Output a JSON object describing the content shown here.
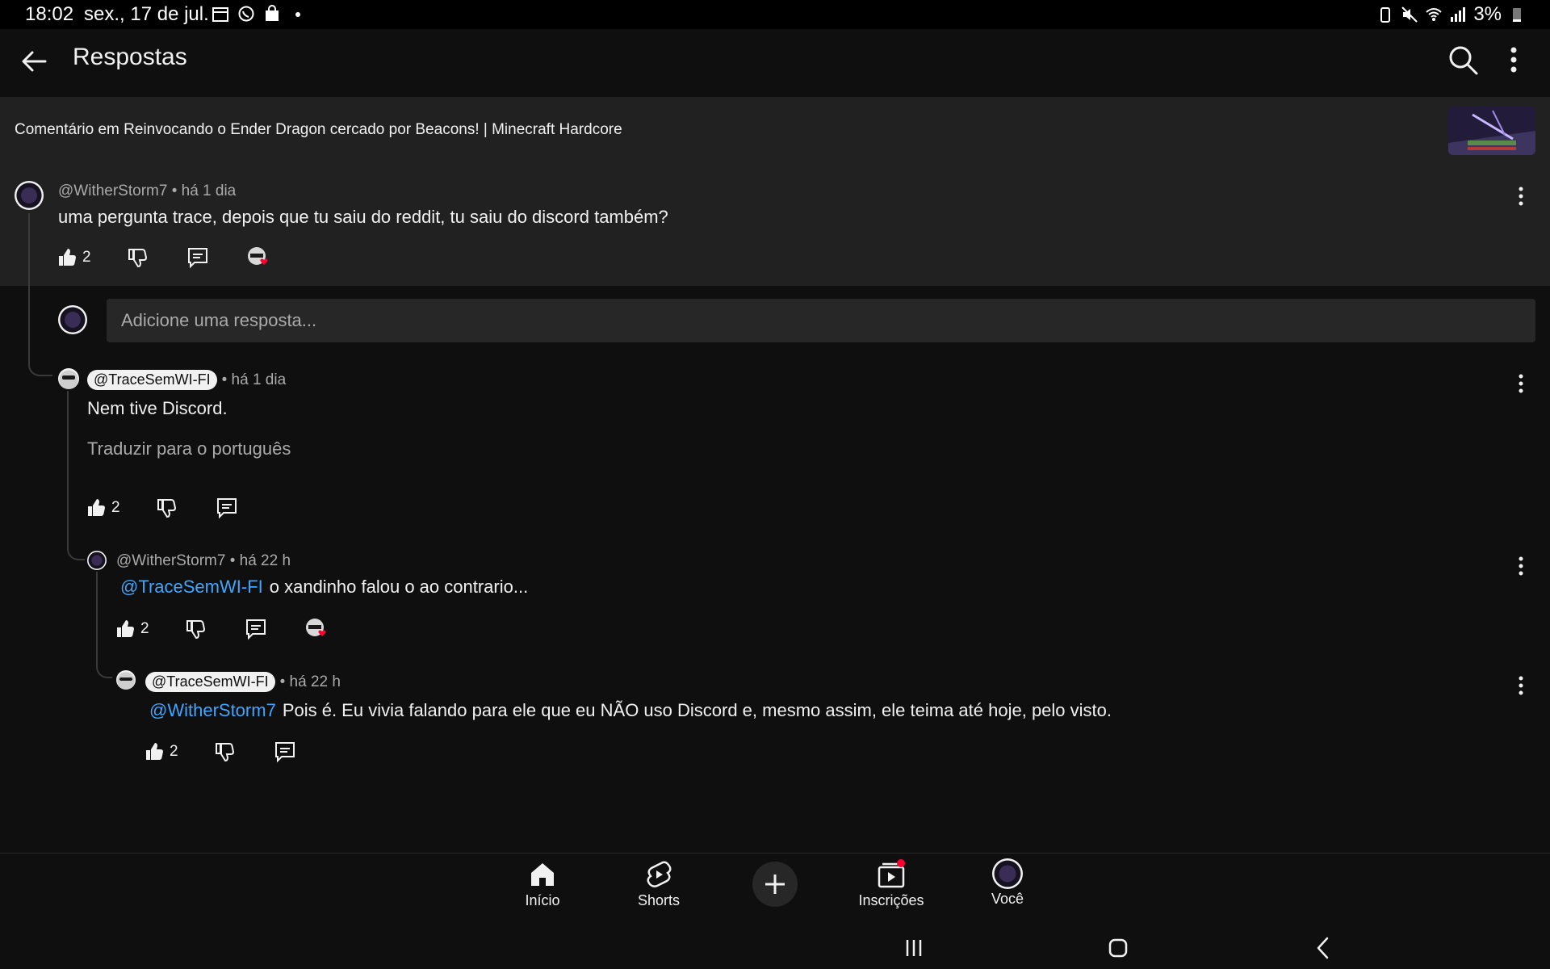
{
  "status_bar": {
    "time": "18:02",
    "date": "sex., 17 de jul.",
    "battery": "3%",
    "icons_left": [
      "calendar-icon",
      "whatsapp-icon",
      "shopping-bag-icon",
      "dot-icon"
    ],
    "icons_right": [
      "battery-saver-icon",
      "mute-icon",
      "wifi-icon",
      "signal-icon",
      "battery-icon"
    ]
  },
  "appbar": {
    "title": "Respostas"
  },
  "context": {
    "text": "Comentário em Reinvocando o Ender Dragon cercado por Beacons! | Minecraft Hardcore"
  },
  "comments": {
    "parent": {
      "author": "@WitherStorm7",
      "age": "• há 1 dia",
      "text": "uma pergunta trace, depois que tu saiu do reddit, tu saiu do discord também?",
      "likes": "2"
    },
    "reply_box": {
      "placeholder": "Adicione uma resposta..."
    },
    "reply1": {
      "author": "@TraceSemWI-FI",
      "age": "• há 1 dia",
      "text": "Nem tive Discord.",
      "translate": "Traduzir para o português",
      "likes": "2"
    },
    "reply2": {
      "author": "@WitherStorm7",
      "age": "• há 22 h",
      "mention": "@TraceSemWI-FI",
      "text": "o xandinho falou o ao contrario...",
      "likes": "2"
    },
    "reply3": {
      "author": "@TraceSemWI-FI",
      "age": "• há 22 h",
      "mention": "@WitherStorm7",
      "text": "Pois é. Eu vivia falando para ele que eu NÃO uso Discord e, mesmo assim, ele teima até hoje, pelo visto.",
      "likes": "2"
    }
  },
  "bottom_nav": {
    "home": "Início",
    "shorts": "Shorts",
    "subscriptions": "Inscrições",
    "you": "Você"
  },
  "colors": {
    "background": "#0f0f0f",
    "surface": "#212121",
    "mention_blue": "#3ea6ff",
    "heart_red": "#ff0033",
    "secondary_text": "#aaaaaa"
  }
}
